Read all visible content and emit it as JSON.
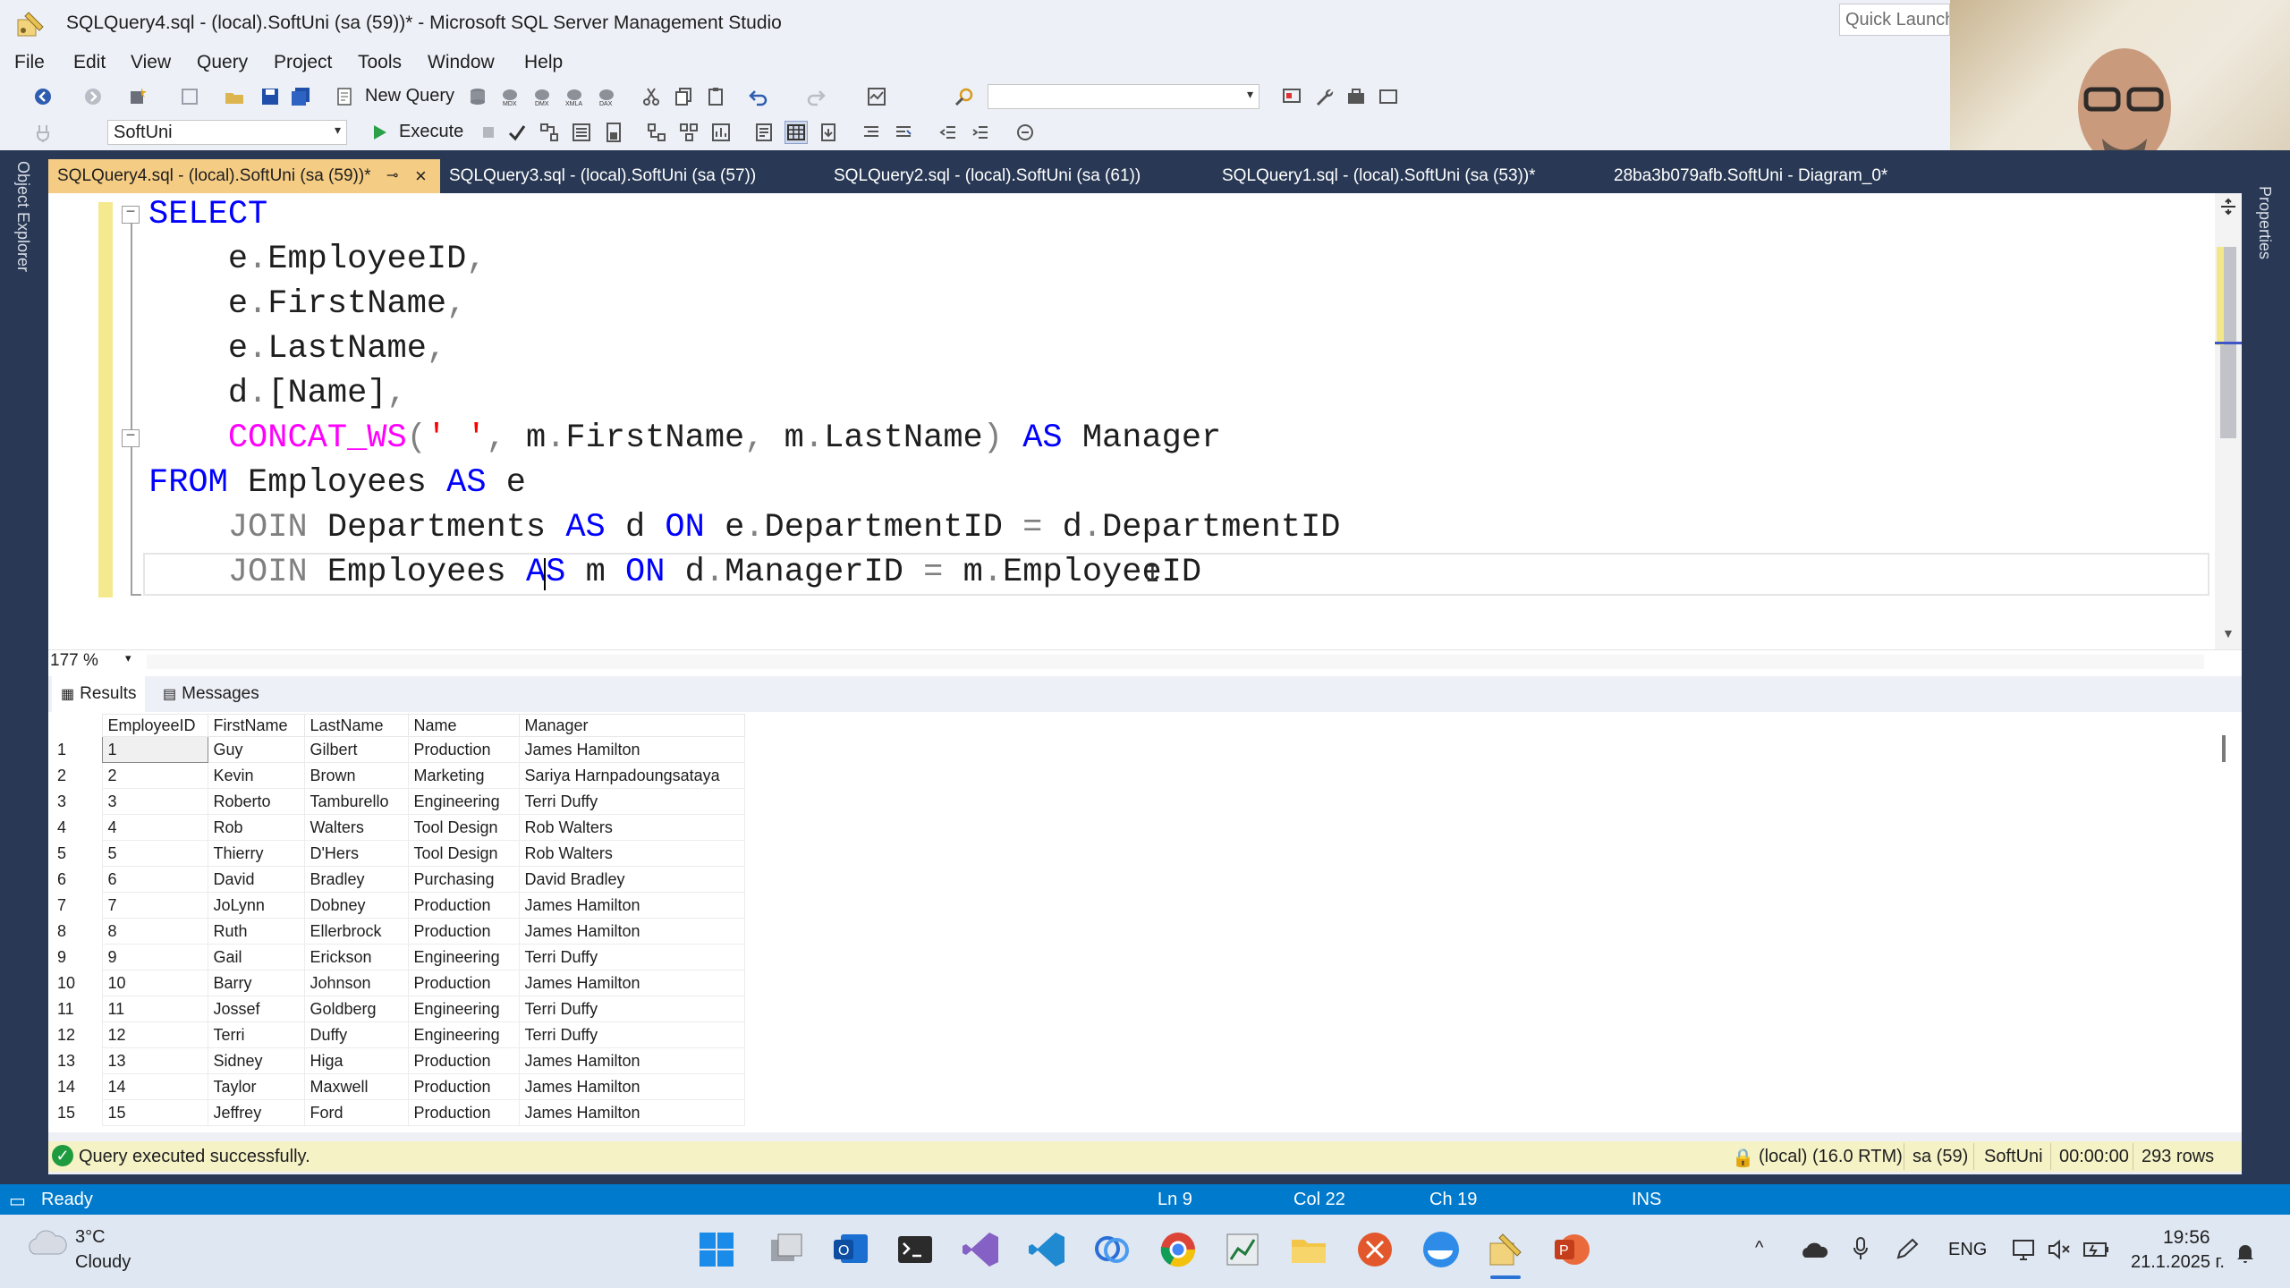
{
  "window": {
    "title": "SQLQuery4.sql - (local).SoftUni (sa (59))* - Microsoft SQL Server Management Studio",
    "quick_launch_placeholder": "Quick Launch"
  },
  "menu": [
    "File",
    "Edit",
    "View",
    "Query",
    "Project",
    "Tools",
    "Window",
    "Help"
  ],
  "toolbar": {
    "new_query_label": "New Query",
    "database_selected": "SoftUni",
    "execute_label": "Execute"
  },
  "side_panels": {
    "left": "Object Explorer",
    "right": "Properties"
  },
  "doc_tabs": [
    {
      "label": "SQLQuery4.sql - (local).SoftUni (sa (59))*",
      "active": true
    },
    {
      "label": "SQLQuery3.sql - (local).SoftUni (sa (57))",
      "active": false
    },
    {
      "label": "SQLQuery2.sql - (local).SoftUni (sa (61))",
      "active": false
    },
    {
      "label": "SQLQuery1.sql - (local).SoftUni (sa (53))*",
      "active": false
    },
    {
      "label": "28ba3b079afb.SoftUni - Diagram_0*",
      "active": false
    }
  ],
  "editor": {
    "zoom": "177 %",
    "lines": [
      "SELECT",
      "    e.EmployeeID,",
      "    e.FirstName,",
      "    e.LastName,",
      "    d.[Name],",
      "    CONCAT_WS(' ', m.FirstName, m.LastName) AS Manager",
      "FROM Employees AS e",
      "    JOIN Departments AS d ON e.DepartmentID = d.DepartmentID",
      "    JOIN Employees AS m ON d.ManagerID = m.EmployeeID"
    ]
  },
  "results": {
    "tabs": [
      "Results",
      "Messages"
    ],
    "columns": [
      "EmployeeID",
      "FirstName",
      "LastName",
      "Name",
      "Manager"
    ],
    "rows": [
      [
        "1",
        "1",
        "Guy",
        "Gilbert",
        "Production",
        "James Hamilton"
      ],
      [
        "2",
        "2",
        "Kevin",
        "Brown",
        "Marketing",
        "Sariya Harnpadoungsataya"
      ],
      [
        "3",
        "3",
        "Roberto",
        "Tamburello",
        "Engineering",
        "Terri Duffy"
      ],
      [
        "4",
        "4",
        "Rob",
        "Walters",
        "Tool Design",
        "Rob Walters"
      ],
      [
        "5",
        "5",
        "Thierry",
        "D'Hers",
        "Tool Design",
        "Rob Walters"
      ],
      [
        "6",
        "6",
        "David",
        "Bradley",
        "Purchasing",
        "David Bradley"
      ],
      [
        "7",
        "7",
        "JoLynn",
        "Dobney",
        "Production",
        "James Hamilton"
      ],
      [
        "8",
        "8",
        "Ruth",
        "Ellerbrock",
        "Production",
        "James Hamilton"
      ],
      [
        "9",
        "9",
        "Gail",
        "Erickson",
        "Engineering",
        "Terri Duffy"
      ],
      [
        "10",
        "10",
        "Barry",
        "Johnson",
        "Production",
        "James Hamilton"
      ],
      [
        "11",
        "11",
        "Jossef",
        "Goldberg",
        "Engineering",
        "Terri Duffy"
      ],
      [
        "12",
        "12",
        "Terri",
        "Duffy",
        "Engineering",
        "Terri Duffy"
      ],
      [
        "13",
        "13",
        "Sidney",
        "Higa",
        "Production",
        "James Hamilton"
      ],
      [
        "14",
        "14",
        "Taylor",
        "Maxwell",
        "Production",
        "James Hamilton"
      ],
      [
        "15",
        "15",
        "Jeffrey",
        "Ford",
        "Production",
        "James Hamilton"
      ]
    ]
  },
  "query_status": {
    "message": "Query executed successfully.",
    "server": "(local) (16.0 RTM)",
    "user": "sa (59)",
    "database": "SoftUni",
    "elapsed": "00:00:00",
    "rows": "293 rows"
  },
  "statusbar": {
    "state": "Ready",
    "ln": "Ln 9",
    "col": "Col 22",
    "ch": "Ch 19",
    "mode": "INS"
  },
  "taskbar": {
    "weather_temp": "3°C",
    "weather_desc": "Cloudy",
    "language": "ENG",
    "time": "19:56",
    "date": "21.1.2025 г."
  },
  "colors": {
    "keyword": "#0000ff",
    "function": "#ff00ff",
    "string": "#ff0000",
    "operator": "#808080",
    "active_tab": "#f5cc84",
    "frame": "#293955",
    "statusbar": "#007acc"
  }
}
